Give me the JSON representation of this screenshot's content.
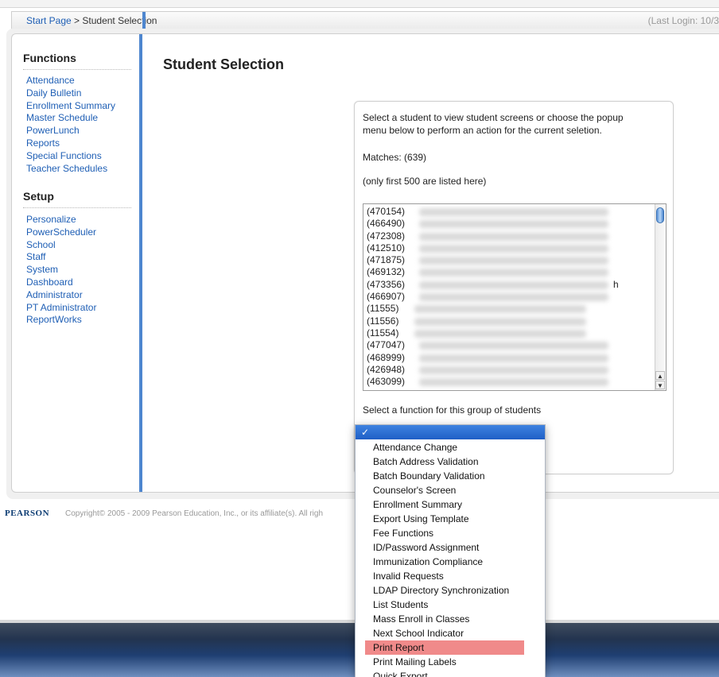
{
  "breadcrumb": {
    "start_page": "Start Page",
    "separator": " > ",
    "current": "Student Selection",
    "last_login": "(Last Login: 10/3"
  },
  "sidebar": {
    "functions_heading": "Functions",
    "functions": [
      "Attendance",
      "Daily Bulletin",
      "Enrollment Summary",
      "Master Schedule",
      "PowerLunch",
      "Reports",
      "Special Functions",
      "Teacher Schedules"
    ],
    "setup_heading": "Setup",
    "setup": [
      "Personalize",
      "PowerScheduler",
      "School",
      "Staff",
      "System",
      "Dashboard",
      "Administrator",
      "PT Administrator",
      "ReportWorks"
    ]
  },
  "main": {
    "title": "Student Selection",
    "instructions_line1": "Select a student to view student screens or choose the popup",
    "instructions_line2": "menu below to perform an action for the current seletion.",
    "matches": "Matches: (639)",
    "limit_note": "(only first 500 are listed here)",
    "function_label": "Select a function for this group of students"
  },
  "students": [
    {
      "id": "(470154)",
      "suffix": ""
    },
    {
      "id": "(466490)",
      "suffix": ""
    },
    {
      "id": "(472308)",
      "suffix": ""
    },
    {
      "id": "(412510)",
      "suffix": ""
    },
    {
      "id": "(471875)",
      "suffix": ""
    },
    {
      "id": "(469132)",
      "suffix": ""
    },
    {
      "id": "(473356)",
      "suffix": "h"
    },
    {
      "id": "(466907)",
      "suffix": ""
    },
    {
      "id": "(11555)",
      "suffix": ""
    },
    {
      "id": "(11556)",
      "suffix": ""
    },
    {
      "id": "(11554)",
      "suffix": ""
    },
    {
      "id": "(477047)",
      "suffix": ""
    },
    {
      "id": "(468999)",
      "suffix": ""
    },
    {
      "id": "(426948)",
      "suffix": ""
    },
    {
      "id": "(463099)",
      "suffix": ""
    }
  ],
  "dropdown": {
    "selected_mark": "✓",
    "options": [
      "Attendance Change",
      "Batch Address Validation",
      "Batch Boundary Validation",
      "Counselor's Screen",
      "Enrollment Summary",
      "Export Using Template",
      "Fee Functions",
      "ID/Password Assignment",
      "Immunization Compliance",
      "Invalid Requests",
      "LDAP Directory Synchronization",
      "List Students",
      "Mass Enroll in Classes",
      "Next School Indicator",
      "Print Report",
      "Print Mailing Labels",
      "Quick Export"
    ],
    "highlighted": "Print Report"
  },
  "footer": {
    "logo": "PEARSON",
    "copyright": "Copyright© 2005 - 2009 Pearson Education, Inc., or its affiliate(s). All righ"
  },
  "colors": {
    "accent_blue": "#4e86cf",
    "link_blue": "#1f5fb5",
    "highlight_red": "#f08a8a"
  }
}
